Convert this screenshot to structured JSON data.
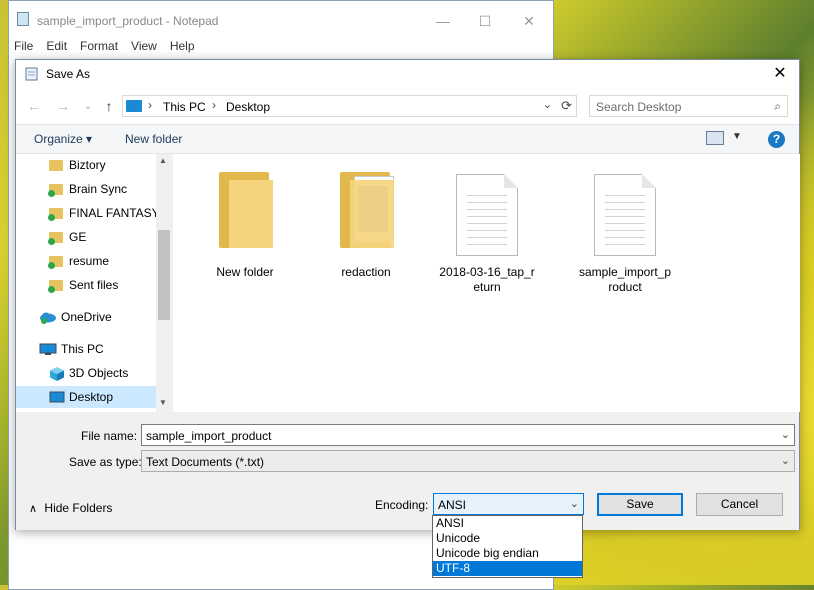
{
  "notepad": {
    "title": "sample_import_product - Notepad",
    "menu": [
      "File",
      "Edit",
      "Format",
      "View",
      "Help"
    ],
    "min_glyph": "—",
    "max_glyph": "☐",
    "close_glyph": "✕"
  },
  "dialog": {
    "title": "Save As",
    "close_glyph": "✕",
    "nav": {
      "back": "←",
      "forward": "→",
      "recent": "⌄",
      "up": "↑"
    },
    "address": {
      "crumbs": [
        "This PC",
        "Desktop"
      ],
      "sep": "›",
      "dropdown": "⌄",
      "refresh": "⟳"
    },
    "search": {
      "placeholder": "Search Desktop",
      "icon": "⌕"
    },
    "toolbar": {
      "organize": "Organize ▾",
      "new_folder": "New folder",
      "view_dd": "▼",
      "help": "?"
    },
    "nav_items": [
      {
        "label": "Biztory",
        "icon": "folder-icon",
        "synced": false
      },
      {
        "label": "Brain Sync",
        "icon": "folder-icon",
        "synced": true
      },
      {
        "label": "FINAL FANTASY",
        "icon": "folder-icon",
        "synced": true
      },
      {
        "label": "GE",
        "icon": "folder-icon",
        "synced": true
      },
      {
        "label": "resume",
        "icon": "folder-icon",
        "synced": true
      },
      {
        "label": "Sent files",
        "icon": "folder-icon",
        "synced": true
      },
      {
        "label": "OneDrive",
        "icon": "onedrive-icon"
      },
      {
        "label": "This PC",
        "icon": "pc-icon"
      },
      {
        "label": "3D Objects",
        "icon": "3d-objects-icon"
      },
      {
        "label": "Desktop",
        "icon": "desktop-icon",
        "selected": true
      }
    ],
    "files": [
      {
        "name": "New folder",
        "type": "folder"
      },
      {
        "name": "redaction",
        "type": "folder"
      },
      {
        "name_line1": "2018-03-16_tap_r",
        "name_line2": "eturn",
        "type": "text"
      },
      {
        "name_line1": "sample_import_p",
        "name_line2": "roduct",
        "type": "text"
      }
    ],
    "file_name": {
      "label": "File name:",
      "value": "sample_import_product",
      "dropdown": "⌄"
    },
    "save_type": {
      "label": "Save as type:",
      "value": "Text Documents (*.txt)",
      "dropdown": "⌄"
    },
    "hide_folders": {
      "label": "Hide Folders",
      "chevron": "∧"
    },
    "encoding": {
      "label": "Encoding:",
      "value": "ANSI",
      "dropdown": "⌄",
      "options": [
        "ANSI",
        "Unicode",
        "Unicode big endian",
        "UTF-8"
      ],
      "highlighted": "UTF-8"
    },
    "buttons": {
      "save": "Save",
      "cancel": "Cancel"
    },
    "scroll": {
      "up": "▲",
      "down": "▼"
    }
  },
  "colors": {
    "accent": "#0078d7",
    "folder": "#f6d47e",
    "selected_nav": "#cce8ff"
  }
}
